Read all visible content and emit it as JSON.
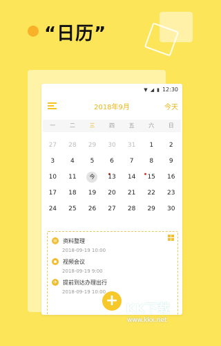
{
  "promo": {
    "title": "“日历”"
  },
  "status": {
    "time": "12:30",
    "wifi_icon": "wifi-icon",
    "signal_icon": "signal-icon",
    "battery_icon": "battery-icon"
  },
  "header": {
    "menu_icon": "menu-icon",
    "month": "2018年9月",
    "today": "今天"
  },
  "weekdays": [
    "一",
    "二",
    "三",
    "四",
    "五",
    "六",
    "日"
  ],
  "calendar": {
    "weeks": [
      [
        "27",
        "28",
        "29",
        "30",
        "31",
        "1",
        "2"
      ],
      [
        "3",
        "4",
        "5",
        "6",
        "7",
        "8",
        "9"
      ],
      [
        "10",
        "11",
        "今",
        "13",
        "14",
        "15",
        "16"
      ],
      [
        "17",
        "18",
        "19",
        "20",
        "21",
        "22",
        "23"
      ],
      [
        "24",
        "25",
        "26",
        "27",
        "28",
        "29",
        "30"
      ]
    ]
  },
  "events": [
    {
      "title": "资料整理",
      "time": "2018-09-19   10:00",
      "icon": "document-icon"
    },
    {
      "title": "视频会议",
      "time": "2018-09-19   9:00",
      "icon": "video-icon"
    },
    {
      "title": "提前到达办理出行",
      "time": "2018-09-19   10:00",
      "icon": "plane-icon"
    }
  ],
  "colors": {
    "background": "#FDE55A",
    "accent": "#F5C423",
    "event_dot": "#E0372A"
  },
  "fab": {
    "label": "+"
  },
  "watermark": {
    "logo": "KK下载",
    "url": "www.kkx.net"
  }
}
